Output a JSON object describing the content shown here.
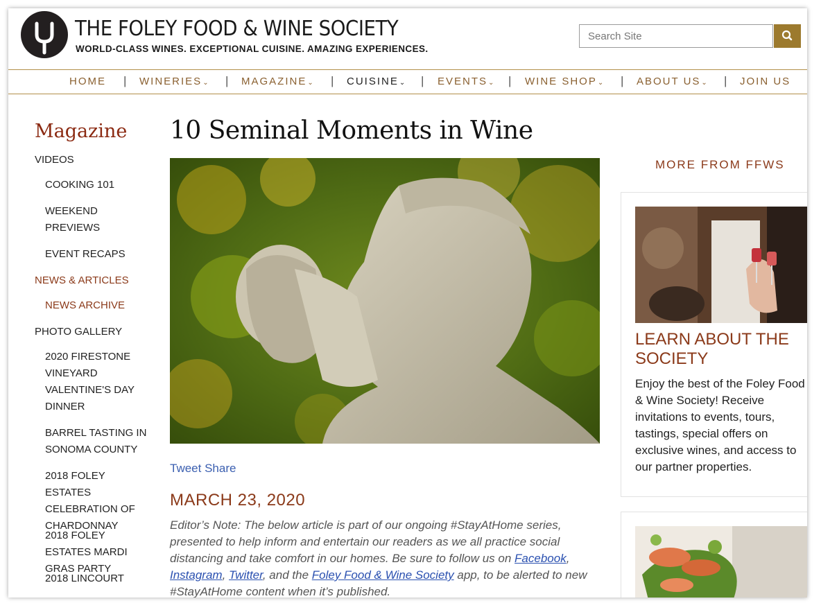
{
  "header": {
    "title": "THE FOLEY FOOD & WINE SOCIETY",
    "tagline": "WORLD-CLASS WINES.  EXCEPTIONAL CUISINE.  AMAZING EXPERIENCES.",
    "search_placeholder": "Search Site"
  },
  "nav": {
    "items": [
      {
        "label": "HOME"
      },
      {
        "label": "WINERIES"
      },
      {
        "label": "MAGAZINE"
      },
      {
        "label": "CUISINE"
      },
      {
        "label": "EVENTS"
      },
      {
        "label": "WINE SHOP"
      },
      {
        "label": "ABOUT US"
      },
      {
        "label": "JOIN US"
      }
    ],
    "separator": "|"
  },
  "sidebar": {
    "title": "Magazine",
    "items": [
      {
        "label": "VIDEOS"
      },
      {
        "label": "COOKING 101"
      },
      {
        "label": "WEEKEND PREVIEWS"
      },
      {
        "label": "EVENT RECAPS"
      },
      {
        "label": "NEWS & ARTICLES"
      },
      {
        "label": "NEWS ARCHIVE"
      },
      {
        "label": "PHOTO GALLERY"
      },
      {
        "label": "2020 FIRESTONE VINEYARD VALENTINE'S DAY DINNER"
      },
      {
        "label": "BARREL TASTING IN SONOMA COUNTY"
      },
      {
        "label": "2018 FOLEY ESTATES CELEBRATION OF CHARDONNAY"
      },
      {
        "label": "2018 FOLEY ESTATES MARDI GRAS PARTY"
      },
      {
        "label": "2018 LINCOURT"
      }
    ]
  },
  "article": {
    "title": "10 Seminal Moments in Wine",
    "share": "Tweet Share",
    "date": "MARCH 23, 2020",
    "note_1": "Editor’s Note: The below article is part of our ongoing #StayAtHome series, presented to help inform and entertain our readers as we all practice social distancing and take comfort in our homes. Be sure to follow us on ",
    "link_facebook": "Facebook",
    "link_instagram": "Instagram",
    "link_twitter": "Twitter",
    "note_2": ", and the ",
    "link_app": "Foley Food & Wine Society",
    "note_3": " app, to be alerted to new #StayAtHome content when it’s published."
  },
  "right": {
    "heading": "MORE FROM FFWS",
    "card_title": "LEARN ABOUT THE SOCIETY",
    "card_text": "Enjoy the best of the Foley Food & Wine Society! Receive invitations to events, tours, tastings, special offers on exclusive wines, and access to our partner properties."
  },
  "colors": {
    "accent_gold": "#9c7a2e",
    "accent_red": "#8b3a1a",
    "link_blue": "#2a50b0"
  },
  "icons": {
    "logo": "tuning-fork-icon",
    "search": "search-icon",
    "dropdown": "chevron-down-icon"
  }
}
